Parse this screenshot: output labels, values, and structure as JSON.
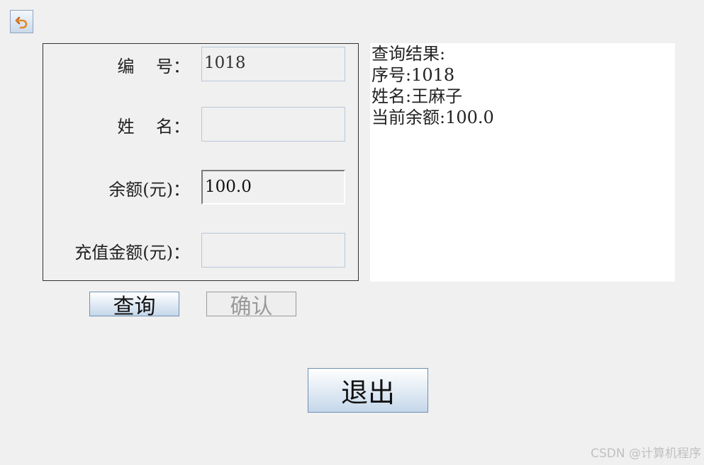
{
  "toolbar": {
    "back_icon": "undo-arrow-icon"
  },
  "form": {
    "id_label": "编    号：",
    "id_value": "1018",
    "name_label": "姓    名：",
    "name_value": "",
    "balance_label": "余额(元)：",
    "balance_value": "100.0",
    "recharge_label": "充值金额(元)：",
    "recharge_value": ""
  },
  "result": {
    "lines": [
      "查询结果:",
      "序号:1018",
      "姓名:王麻子",
      "当前余额:100.0"
    ]
  },
  "buttons": {
    "query": "查询",
    "confirm": "确认",
    "exit": "退出"
  },
  "watermark": "CSDN @计算机程序",
  "colors": {
    "background": "#f0f0f0",
    "button_gradient_bottom": "#c5d7ea",
    "disabled_text": "#9a9a9a"
  }
}
